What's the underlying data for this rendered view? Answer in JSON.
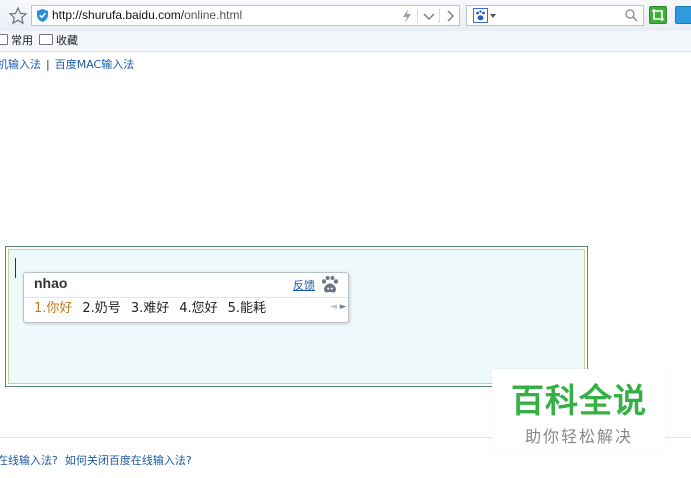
{
  "browser": {
    "url_host": "http://shurufa.baidu.com/",
    "url_path": "online.html"
  },
  "bookmarks": {
    "items": [
      {
        "label": "常用"
      },
      {
        "label": "收藏"
      }
    ]
  },
  "page": {
    "top_links": [
      {
        "label": "机输入法"
      },
      {
        "label": "百度MAC输入法"
      }
    ],
    "top_sep": "|",
    "footer_links": [
      {
        "label": "在线输入法?"
      },
      {
        "label": "如何关闭百度在线输入法?"
      }
    ]
  },
  "ime": {
    "pinyin": "nhao",
    "feedback_label": "反馈",
    "candidates": [
      {
        "label": "1.你好"
      },
      {
        "label": "2.奶号"
      },
      {
        "label": "3.难好"
      },
      {
        "label": "4.您好"
      },
      {
        "label": "5.能耗"
      }
    ],
    "pager_prev": "◄",
    "pager_next": "►"
  },
  "watermark": {
    "title": "百科全说",
    "subtitle": "助你轻松解决"
  },
  "colors": {
    "accent_green": "#35b045",
    "link_blue": "#1a5aa8",
    "candidate_highlight": "#c0781b"
  }
}
